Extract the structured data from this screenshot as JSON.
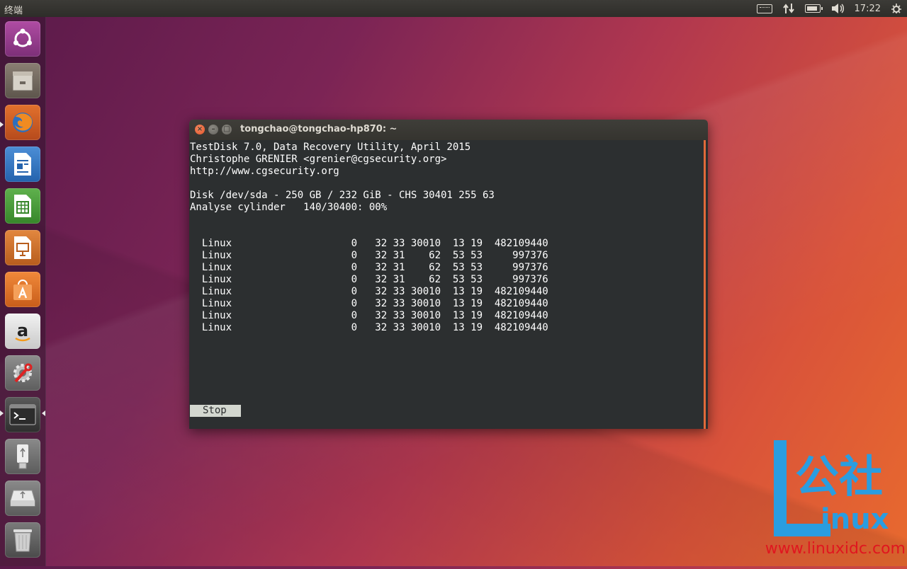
{
  "top_panel": {
    "app_title": "终端",
    "clock": "17:22"
  },
  "launcher": {
    "items": [
      {
        "name": "ubuntu-dash-icon"
      },
      {
        "name": "files-icon"
      },
      {
        "name": "firefox-icon"
      },
      {
        "name": "libreoffice-writer-icon"
      },
      {
        "name": "libreoffice-calc-icon"
      },
      {
        "name": "libreoffice-impress-icon"
      },
      {
        "name": "software-center-icon"
      },
      {
        "name": "amazon-icon"
      },
      {
        "name": "system-settings-icon"
      },
      {
        "name": "terminal-icon"
      },
      {
        "name": "usb-drive-icon"
      },
      {
        "name": "disk-drive-icon"
      },
      {
        "name": "trash-icon"
      }
    ]
  },
  "window": {
    "title": "tongchao@tongchao-hp870: ~"
  },
  "terminal": {
    "header_lines": [
      "TestDisk 7.0, Data Recovery Utility, April 2015",
      "Christophe GRENIER <grenier@cgsecurity.org>",
      "http://www.cgsecurity.org",
      "",
      "Disk /dev/sda - 250 GB / 232 GiB - CHS 30401 255 63",
      "Analyse cylinder   140/30400: 00%"
    ],
    "partitions": [
      {
        "type": "Linux",
        "c1": "0",
        "h1": "32",
        "s1": "33",
        "c2": "30010",
        "h2": "13",
        "s2": "19",
        "size": "482109440"
      },
      {
        "type": "Linux",
        "c1": "0",
        "h1": "32",
        "s1": "31",
        "c2": "62",
        "h2": "53",
        "s2": "53",
        "size": "997376"
      },
      {
        "type": "Linux",
        "c1": "0",
        "h1": "32",
        "s1": "31",
        "c2": "62",
        "h2": "53",
        "s2": "53",
        "size": "997376"
      },
      {
        "type": "Linux",
        "c1": "0",
        "h1": "32",
        "s1": "31",
        "c2": "62",
        "h2": "53",
        "s2": "53",
        "size": "997376"
      },
      {
        "type": "Linux",
        "c1": "0",
        "h1": "32",
        "s1": "33",
        "c2": "30010",
        "h2": "13",
        "s2": "19",
        "size": "482109440"
      },
      {
        "type": "Linux",
        "c1": "0",
        "h1": "32",
        "s1": "33",
        "c2": "30010",
        "h2": "13",
        "s2": "19",
        "size": "482109440"
      },
      {
        "type": "Linux",
        "c1": "0",
        "h1": "32",
        "s1": "33",
        "c2": "30010",
        "h2": "13",
        "s2": "19",
        "size": "482109440"
      },
      {
        "type": "Linux",
        "c1": "0",
        "h1": "32",
        "s1": "33",
        "c2": "30010",
        "h2": "13",
        "s2": "19",
        "size": "482109440"
      }
    ],
    "stop_label": "Stop"
  },
  "watermark": {
    "logo_text": "L公社 inux",
    "url": "www.linuxidc.com"
  }
}
